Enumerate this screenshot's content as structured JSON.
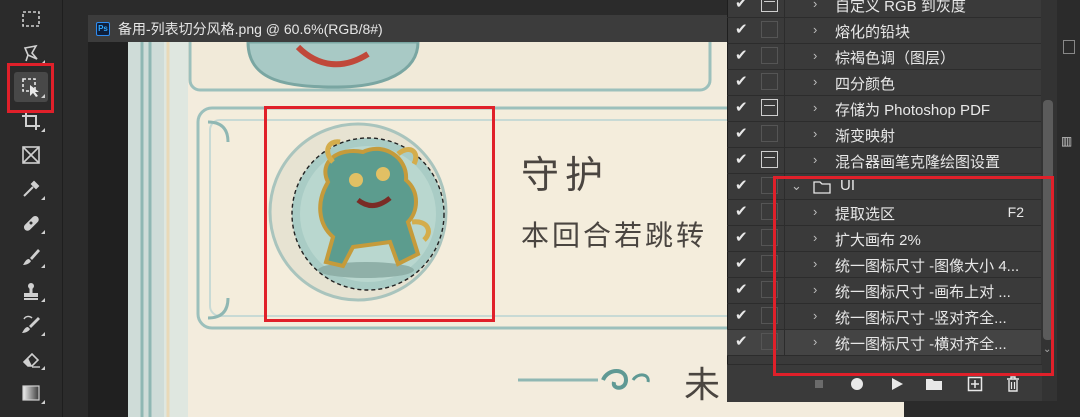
{
  "document": {
    "title": "备用-列表切分风格.png @ 60.6%(RGB/8#)",
    "card_title": "守护",
    "card_desc": "本回合若跳转",
    "next_title": "未"
  },
  "toolbar": {
    "tools": [
      "marquee-tool",
      "lasso-tool",
      "object-selection-tool",
      "crop-tool",
      "frame-tool",
      "eyedropper-tool",
      "healing-brush-tool",
      "brush-tool",
      "clone-stamp-tool",
      "history-brush-tool",
      "eraser-tool",
      "gradient-tool"
    ]
  },
  "actions": {
    "rows": [
      {
        "check": "✔",
        "dialog": true,
        "expand": "›",
        "label": "自定义 RGB 到灰度"
      },
      {
        "check": "✔",
        "dialog": false,
        "expand": "›",
        "label": "熔化的铅块"
      },
      {
        "check": "✔",
        "dialog": false,
        "expand": "›",
        "label": "棕褐色调（图层）"
      },
      {
        "check": "✔",
        "dialog": false,
        "expand": "›",
        "label": "四分颜色"
      },
      {
        "check": "✔",
        "dialog": true,
        "expand": "›",
        "label": "存储为 Photoshop PDF"
      },
      {
        "check": "✔",
        "dialog": false,
        "expand": "›",
        "label": "渐变映射"
      },
      {
        "check": "✔",
        "dialog": true,
        "expand": "›",
        "label": "混合器画笔克隆绘图设置"
      },
      {
        "check": "✔",
        "dialog": false,
        "expand": "⌄",
        "label": "UI",
        "set": true
      },
      {
        "check": "✔",
        "dialog": false,
        "expand": "›",
        "label": "提取选区",
        "shortcut": "F2"
      },
      {
        "check": "✔",
        "dialog": false,
        "expand": "›",
        "label": "扩大画布 2%"
      },
      {
        "check": "✔",
        "dialog": false,
        "expand": "›",
        "label": "统一图标尺寸 -图像大小 4..."
      },
      {
        "check": "✔",
        "dialog": false,
        "expand": "›",
        "label": "统一图标尺寸 -画布上对 ..."
      },
      {
        "check": "✔",
        "dialog": false,
        "expand": "›",
        "label": "统一图标尺寸 -竖对齐全..."
      },
      {
        "check": "✔",
        "dialog": false,
        "expand": "›",
        "label": "统一图标尺寸 -横对齐全...",
        "selected": true
      }
    ],
    "bottom_buttons": [
      "stop-icon",
      "record-icon",
      "play-icon",
      "folder-icon",
      "new-action-icon",
      "trash-icon"
    ]
  },
  "colors": {
    "highlight_red": "#e0202a",
    "ui_bg": "#3a3a3a",
    "canvas_bg": "#f3ecdd",
    "teal": "#8fb7b3"
  }
}
